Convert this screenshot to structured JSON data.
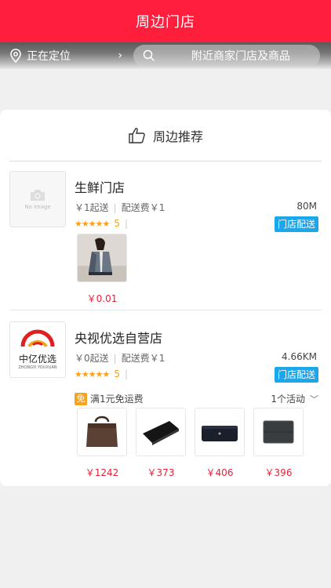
{
  "header": {
    "title": "周边门店"
  },
  "location": {
    "label": "正在定位",
    "chevron": "›"
  },
  "search": {
    "placeholder": "附近商家门店及商品"
  },
  "section": {
    "title": "周边推荐"
  },
  "stores": [
    {
      "name": "生鲜门店",
      "logo_placeholder": "No image",
      "min_order": "￥1起送",
      "delivery_fee": "配送费￥1",
      "distance": "80M",
      "stars": "★★★★★",
      "rating": "5",
      "rating_sep": "|",
      "meta_sep": "|",
      "tag": "门店配送",
      "goods": [
        {
          "price": "￥0.01"
        }
      ]
    },
    {
      "name": "央视优选自营店",
      "logo_text": "中亿优选",
      "logo_subtext": "ZHONGYI YOUXUAN",
      "min_order": "￥0起送",
      "delivery_fee": "配送费￥1",
      "distance": "4.66KM",
      "stars": "★★★★★",
      "rating": "5",
      "rating_sep": "|",
      "meta_sep": "|",
      "tag": "门店配送",
      "promo_badge": "免",
      "promo_text": "满1元免运费",
      "activity": "1个活动",
      "activity_chevron": "﹀",
      "goods": [
        {
          "price": "￥1242"
        },
        {
          "price": "￥373"
        },
        {
          "price": "￥406"
        },
        {
          "price": "￥396"
        }
      ]
    }
  ],
  "colors": {
    "brand": "#ff1e3c",
    "tag": "#1aa7ec",
    "star": "#f7a21a",
    "price": "#e8203a"
  },
  "icons": {
    "location": "location-pin-icon",
    "search": "search-icon",
    "recommend": "thumbs-up-icon"
  }
}
